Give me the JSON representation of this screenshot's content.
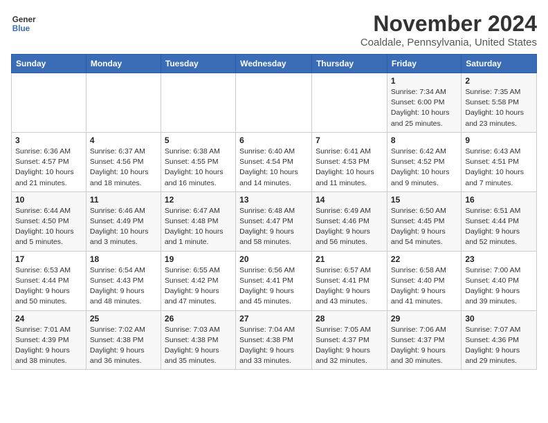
{
  "header": {
    "logo_line1": "General",
    "logo_line2": "Blue",
    "month": "November 2024",
    "location": "Coaldale, Pennsylvania, United States"
  },
  "weekdays": [
    "Sunday",
    "Monday",
    "Tuesday",
    "Wednesday",
    "Thursday",
    "Friday",
    "Saturday"
  ],
  "weeks": [
    [
      {
        "day": "",
        "info": ""
      },
      {
        "day": "",
        "info": ""
      },
      {
        "day": "",
        "info": ""
      },
      {
        "day": "",
        "info": ""
      },
      {
        "day": "",
        "info": ""
      },
      {
        "day": "1",
        "info": "Sunrise: 7:34 AM\nSunset: 6:00 PM\nDaylight: 10 hours and 25 minutes."
      },
      {
        "day": "2",
        "info": "Sunrise: 7:35 AM\nSunset: 5:58 PM\nDaylight: 10 hours and 23 minutes."
      }
    ],
    [
      {
        "day": "3",
        "info": "Sunrise: 6:36 AM\nSunset: 4:57 PM\nDaylight: 10 hours and 21 minutes."
      },
      {
        "day": "4",
        "info": "Sunrise: 6:37 AM\nSunset: 4:56 PM\nDaylight: 10 hours and 18 minutes."
      },
      {
        "day": "5",
        "info": "Sunrise: 6:38 AM\nSunset: 4:55 PM\nDaylight: 10 hours and 16 minutes."
      },
      {
        "day": "6",
        "info": "Sunrise: 6:40 AM\nSunset: 4:54 PM\nDaylight: 10 hours and 14 minutes."
      },
      {
        "day": "7",
        "info": "Sunrise: 6:41 AM\nSunset: 4:53 PM\nDaylight: 10 hours and 11 minutes."
      },
      {
        "day": "8",
        "info": "Sunrise: 6:42 AM\nSunset: 4:52 PM\nDaylight: 10 hours and 9 minutes."
      },
      {
        "day": "9",
        "info": "Sunrise: 6:43 AM\nSunset: 4:51 PM\nDaylight: 10 hours and 7 minutes."
      }
    ],
    [
      {
        "day": "10",
        "info": "Sunrise: 6:44 AM\nSunset: 4:50 PM\nDaylight: 10 hours and 5 minutes."
      },
      {
        "day": "11",
        "info": "Sunrise: 6:46 AM\nSunset: 4:49 PM\nDaylight: 10 hours and 3 minutes."
      },
      {
        "day": "12",
        "info": "Sunrise: 6:47 AM\nSunset: 4:48 PM\nDaylight: 10 hours and 1 minute."
      },
      {
        "day": "13",
        "info": "Sunrise: 6:48 AM\nSunset: 4:47 PM\nDaylight: 9 hours and 58 minutes."
      },
      {
        "day": "14",
        "info": "Sunrise: 6:49 AM\nSunset: 4:46 PM\nDaylight: 9 hours and 56 minutes."
      },
      {
        "day": "15",
        "info": "Sunrise: 6:50 AM\nSunset: 4:45 PM\nDaylight: 9 hours and 54 minutes."
      },
      {
        "day": "16",
        "info": "Sunrise: 6:51 AM\nSunset: 4:44 PM\nDaylight: 9 hours and 52 minutes."
      }
    ],
    [
      {
        "day": "17",
        "info": "Sunrise: 6:53 AM\nSunset: 4:44 PM\nDaylight: 9 hours and 50 minutes."
      },
      {
        "day": "18",
        "info": "Sunrise: 6:54 AM\nSunset: 4:43 PM\nDaylight: 9 hours and 48 minutes."
      },
      {
        "day": "19",
        "info": "Sunrise: 6:55 AM\nSunset: 4:42 PM\nDaylight: 9 hours and 47 minutes."
      },
      {
        "day": "20",
        "info": "Sunrise: 6:56 AM\nSunset: 4:41 PM\nDaylight: 9 hours and 45 minutes."
      },
      {
        "day": "21",
        "info": "Sunrise: 6:57 AM\nSunset: 4:41 PM\nDaylight: 9 hours and 43 minutes."
      },
      {
        "day": "22",
        "info": "Sunrise: 6:58 AM\nSunset: 4:40 PM\nDaylight: 9 hours and 41 minutes."
      },
      {
        "day": "23",
        "info": "Sunrise: 7:00 AM\nSunset: 4:40 PM\nDaylight: 9 hours and 39 minutes."
      }
    ],
    [
      {
        "day": "24",
        "info": "Sunrise: 7:01 AM\nSunset: 4:39 PM\nDaylight: 9 hours and 38 minutes."
      },
      {
        "day": "25",
        "info": "Sunrise: 7:02 AM\nSunset: 4:38 PM\nDaylight: 9 hours and 36 minutes."
      },
      {
        "day": "26",
        "info": "Sunrise: 7:03 AM\nSunset: 4:38 PM\nDaylight: 9 hours and 35 minutes."
      },
      {
        "day": "27",
        "info": "Sunrise: 7:04 AM\nSunset: 4:38 PM\nDaylight: 9 hours and 33 minutes."
      },
      {
        "day": "28",
        "info": "Sunrise: 7:05 AM\nSunset: 4:37 PM\nDaylight: 9 hours and 32 minutes."
      },
      {
        "day": "29",
        "info": "Sunrise: 7:06 AM\nSunset: 4:37 PM\nDaylight: 9 hours and 30 minutes."
      },
      {
        "day": "30",
        "info": "Sunrise: 7:07 AM\nSunset: 4:36 PM\nDaylight: 9 hours and 29 minutes."
      }
    ]
  ]
}
